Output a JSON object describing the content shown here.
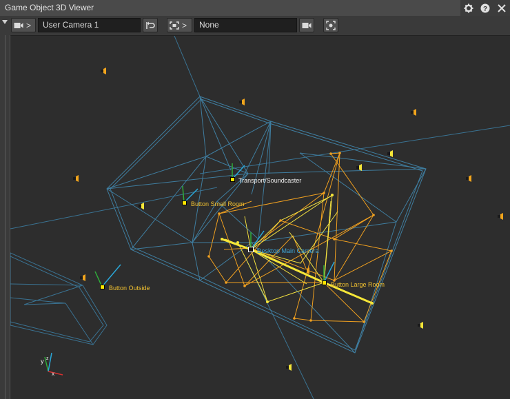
{
  "window": {
    "title": "Game Object 3D Viewer"
  },
  "title_icons": [
    "gear-icon",
    "help-icon",
    "close-icon"
  ],
  "toolbar": {
    "camera_separator": ">",
    "camera_name": "User Camera 1",
    "listener_separator": ">",
    "listener_name": "None"
  },
  "scene": {
    "labels": {
      "transport": "Transport/Soundcaster",
      "button_small_room": "Button Small Room",
      "desktop_main_camera": "Desktop Main Camera",
      "button_large_room": "Button Large Room",
      "button_outside": "Button Outside"
    },
    "axis_gizmo": {
      "y": "y",
      "z": "z",
      "x": "x"
    }
  },
  "colors": {
    "room_wire": "#3f7d9f",
    "rays_orange": "#f0a020",
    "rays_yellow": "#f2e040",
    "label_yellow": "#f0c030",
    "label_white": "#f0f0f0",
    "label_cyan": "#3fa6d8"
  }
}
